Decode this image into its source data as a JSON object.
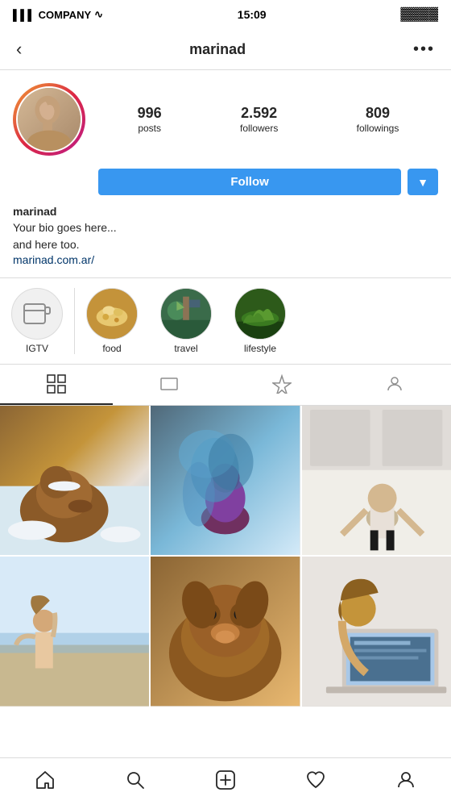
{
  "status": {
    "carrier": "COMPANY",
    "time": "15:09"
  },
  "nav": {
    "username": "marinad",
    "back_label": "‹",
    "more_label": "•••"
  },
  "profile": {
    "stats": {
      "posts_count": "996",
      "posts_label": "posts",
      "followers_count": "2.592",
      "followers_label": "followers",
      "followings_count": "809",
      "followings_label": "followings"
    },
    "follow_label": "Follow",
    "dropdown_icon": "▼",
    "name": "marinad",
    "bio_line1": "Your bio goes here...",
    "bio_line2": "and here too.",
    "bio_link": "marinad.com.ar/"
  },
  "highlights": [
    {
      "id": "igtv",
      "label": "IGTV",
      "type": "igtv"
    },
    {
      "id": "food",
      "label": "food",
      "type": "food"
    },
    {
      "id": "travel",
      "label": "travel",
      "type": "travel"
    },
    {
      "id": "lifestyle",
      "label": "lifestyle",
      "type": "lifestyle"
    }
  ],
  "tabs": [
    {
      "id": "grid",
      "icon": "⊞",
      "active": true
    },
    {
      "id": "reels",
      "icon": "▭",
      "active": false
    },
    {
      "id": "tagged-star",
      "icon": "☆",
      "active": false
    },
    {
      "id": "tagged",
      "icon": "◻",
      "active": false
    }
  ],
  "bottom_nav": [
    {
      "id": "home",
      "icon": "⌂"
    },
    {
      "id": "search",
      "icon": "⌕"
    },
    {
      "id": "add",
      "icon": "⊕"
    },
    {
      "id": "heart",
      "icon": "♡"
    },
    {
      "id": "profile",
      "icon": "◉"
    }
  ]
}
